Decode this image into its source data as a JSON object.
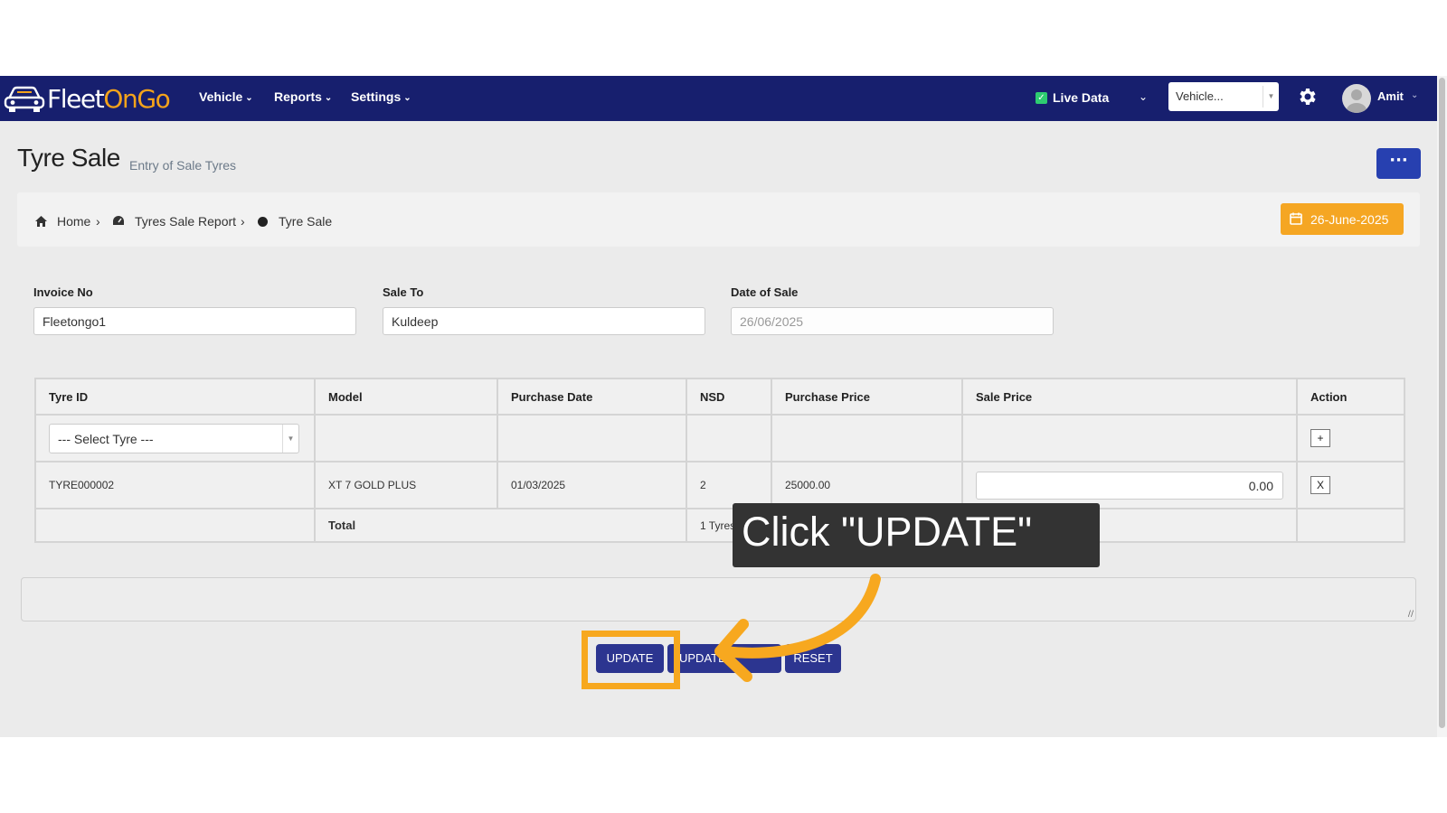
{
  "navbar": {
    "logo_part1": "Fleet",
    "logo_part2": "OnGo",
    "menus": [
      "Vehicle",
      "Reports",
      "Settings"
    ],
    "live_data_label": "Live Data",
    "live_data_checked": true,
    "vehicle_select_value": "Vehicle...",
    "user_name": "Amit"
  },
  "page": {
    "title": "Tyre Sale",
    "subtitle": "Entry of Sale Tyres",
    "date_badge": "26-June-2025"
  },
  "breadcrumb": [
    "Home",
    "Tyres Sale Report",
    "Tyre Sale"
  ],
  "form": {
    "invoice_label": "Invoice No",
    "invoice_value": "Fleetongo1",
    "sale_to_label": "Sale To",
    "sale_to_value": "Kuldeep",
    "date_label": "Date of Sale",
    "date_value": "26/06/2025"
  },
  "table": {
    "headers": [
      "Tyre ID",
      "Model",
      "Purchase Date",
      "NSD",
      "Purchase Price",
      "Sale Price",
      "Action"
    ],
    "select_placeholder": "--- Select Tyre ---",
    "add_btn": "+",
    "rows": [
      {
        "tyre_id": "TYRE000002",
        "model": "XT 7 GOLD PLUS",
        "purchase_date": "01/03/2025",
        "nsd": "2",
        "purchase_price": "25000.00",
        "sale_price": "0.00",
        "remove_btn": "X"
      }
    ],
    "total_label": "Total",
    "total_tyres": "1 Tyres"
  },
  "buttons": {
    "update": "UPDATE",
    "update2": "UPDATE",
    "reset": "RESET"
  },
  "annotation": {
    "tooltip_text": "Click \"UPDATE\"",
    "highlight_color": "#f7a81f"
  },
  "colors": {
    "navbar": "#171f6e",
    "accent_orange": "#f5a623",
    "button_blue": "#2c3590"
  }
}
